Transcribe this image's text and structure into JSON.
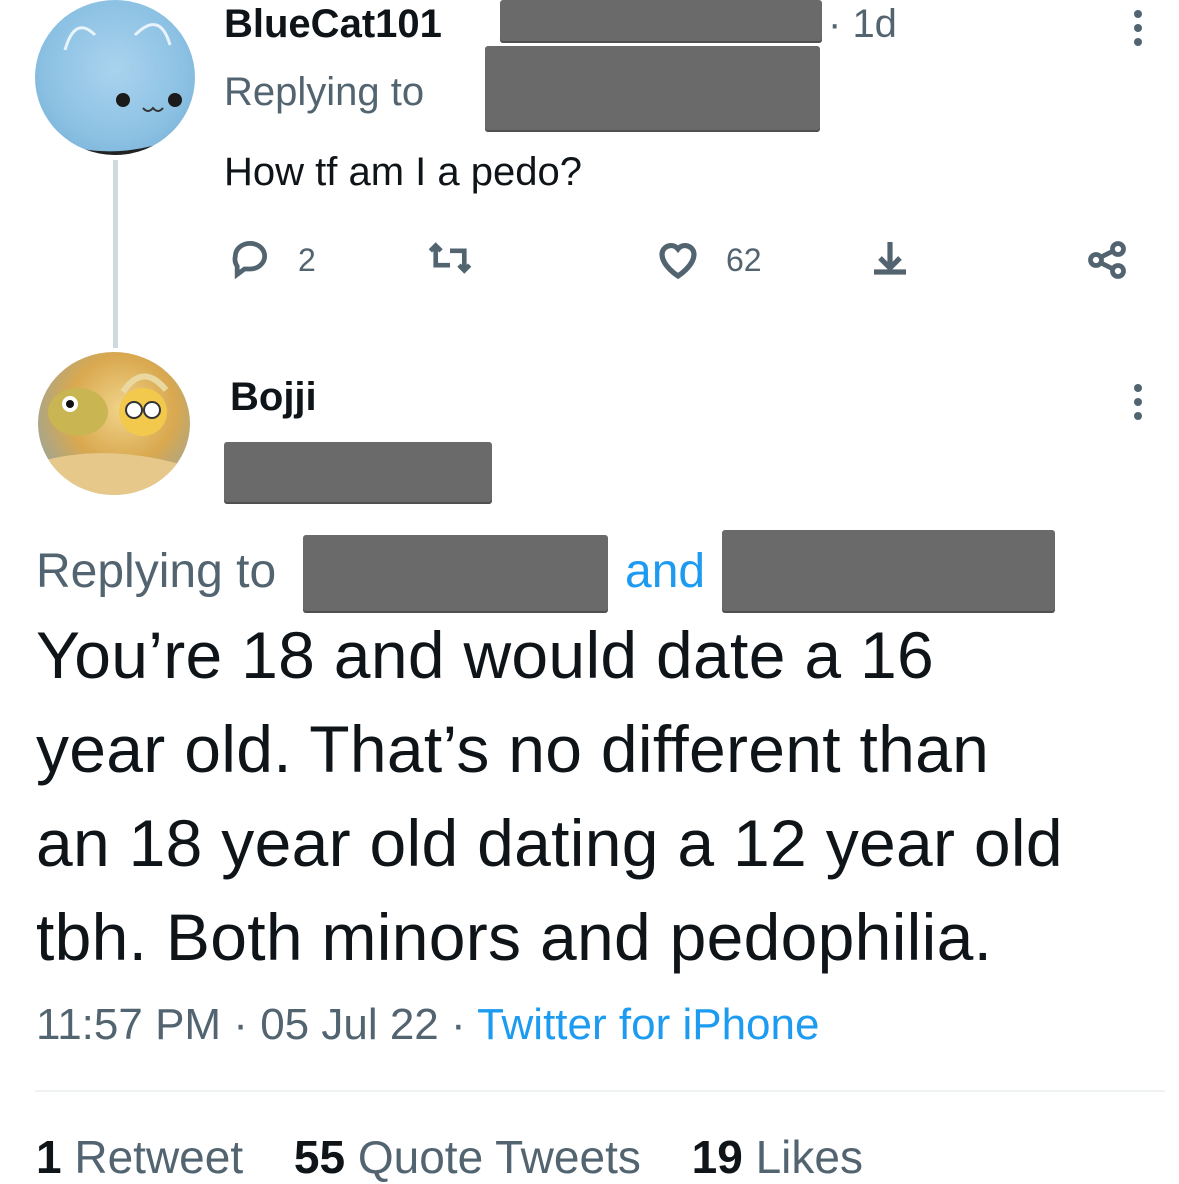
{
  "reply_tweet": {
    "display_name": "BlueCat101",
    "time_ago": "1d",
    "replying_to_label": "Replying to",
    "text": "How tf am I a pedo?",
    "actions": {
      "reply_count": "2",
      "like_count": "62"
    }
  },
  "main_tweet": {
    "display_name": "Bojji",
    "replying_to_label": "Replying to",
    "and_label": "and",
    "text_lines": [
      "You’re 18 and would date a 16",
      "year old.  That’s no different than",
      "an 18 year old dating a 12 year old",
      "tbh. Both minors and pedophilia."
    ],
    "time": "11:57 PM",
    "date": "05 Jul 22",
    "source": "Twitter for iPhone"
  },
  "stats": {
    "retweets_count": "1",
    "retweets_label": "Retweet",
    "quotes_count": "55",
    "quotes_label": "Quote Tweets",
    "likes_count": "19",
    "likes_label": "Likes"
  },
  "colors": {
    "accent": "#1d9bf0",
    "secondary_text": "#536471",
    "redaction": "#6a6a6a"
  },
  "icons": [
    "reply-icon",
    "retweet-icon",
    "like-icon",
    "share-icon",
    "share-link-icon",
    "more-icon"
  ]
}
